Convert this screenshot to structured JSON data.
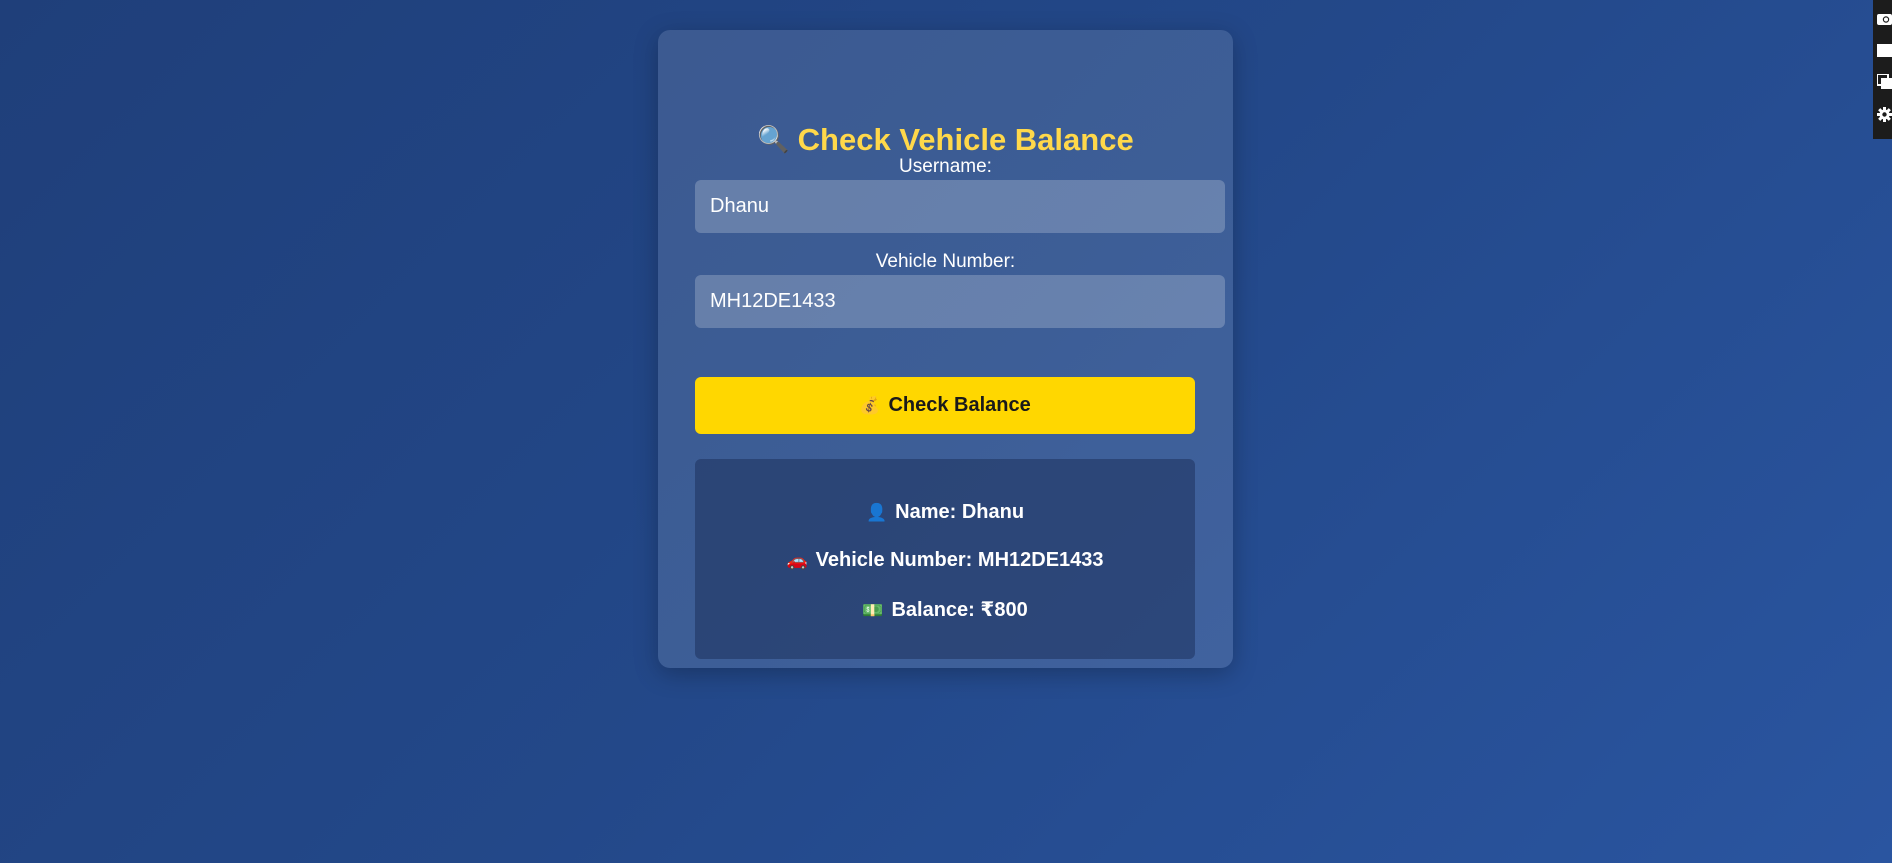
{
  "form": {
    "title": "Check Vehicle Balance",
    "title_icon": "🔍",
    "username_label": "Username:",
    "username_value": "Dhanu",
    "vehicle_label": "Vehicle Number:",
    "vehicle_value": "MH12DE1433",
    "check_button_icon": "💰",
    "check_button_label": "Check Balance"
  },
  "result": {
    "name_icon": "👤",
    "name_label": "Name:",
    "name_value": "Dhanu",
    "vehicle_icon": "🚗",
    "vehicle_label": "Vehicle Number:",
    "vehicle_value": "MH12DE1433",
    "balance_icon": "💵",
    "balance_label": "Balance:",
    "balance_value": "₹800"
  },
  "colors": {
    "title": "#ffd84a",
    "button": "#ffd700",
    "background": "#234889"
  },
  "toolbar_icons": [
    "camera-icon",
    "square-icon",
    "copy-icon",
    "gear-icon"
  ]
}
